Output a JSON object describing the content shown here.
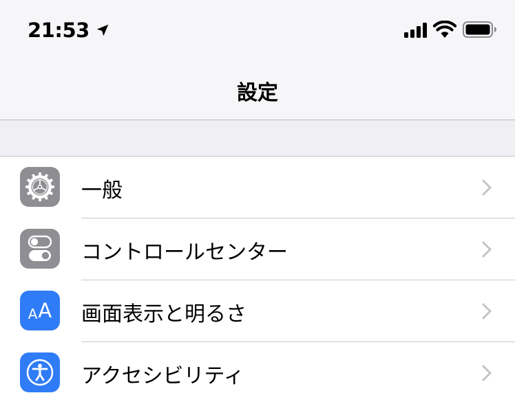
{
  "status_bar": {
    "time": "21:53",
    "location_icon": "location-arrow-icon",
    "signal_icon": "cellular-signal-icon",
    "wifi_icon": "wifi-icon",
    "battery_icon": "battery-icon"
  },
  "nav": {
    "title": "設定"
  },
  "settings": {
    "items": [
      {
        "label": "一般",
        "icon": "gear-icon",
        "icon_bg": "#8e8e93"
      },
      {
        "label": "コントロールセンター",
        "icon": "toggle-switches-icon",
        "icon_bg": "#8e8e93"
      },
      {
        "label": "画面表示と明るさ",
        "icon_text_small": "A",
        "icon_text_big": "A",
        "icon": "text-size-icon",
        "icon_bg": "#2f7cf6"
      },
      {
        "label": "アクセシビリティ",
        "icon": "accessibility-icon",
        "icon_bg": "#2f7cf6"
      }
    ]
  },
  "colors": {
    "chevron": "#c4c4c7",
    "separator": "#c8c7cc",
    "header_bg": "#f6f6f8",
    "group_bg": "#efeff4"
  }
}
